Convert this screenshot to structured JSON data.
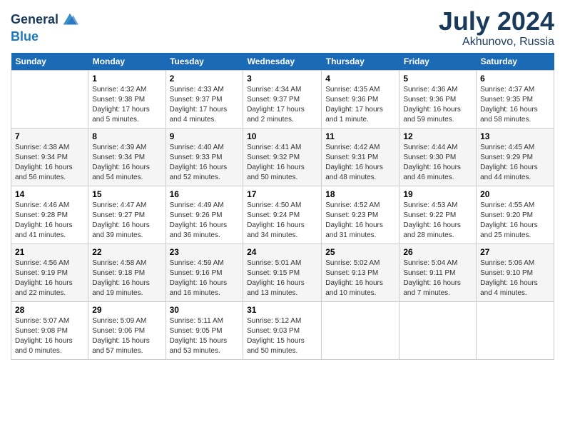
{
  "header": {
    "logo_line1": "General",
    "logo_line2": "Blue",
    "month": "July 2024",
    "location": "Akhunovo, Russia"
  },
  "days_of_week": [
    "Sunday",
    "Monday",
    "Tuesday",
    "Wednesday",
    "Thursday",
    "Friday",
    "Saturday"
  ],
  "weeks": [
    [
      {
        "day": "",
        "sunrise": "",
        "sunset": "",
        "daylight": ""
      },
      {
        "day": "1",
        "sunrise": "Sunrise: 4:32 AM",
        "sunset": "Sunset: 9:38 PM",
        "daylight": "Daylight: 17 hours and 5 minutes."
      },
      {
        "day": "2",
        "sunrise": "Sunrise: 4:33 AM",
        "sunset": "Sunset: 9:37 PM",
        "daylight": "Daylight: 17 hours and 4 minutes."
      },
      {
        "day": "3",
        "sunrise": "Sunrise: 4:34 AM",
        "sunset": "Sunset: 9:37 PM",
        "daylight": "Daylight: 17 hours and 2 minutes."
      },
      {
        "day": "4",
        "sunrise": "Sunrise: 4:35 AM",
        "sunset": "Sunset: 9:36 PM",
        "daylight": "Daylight: 17 hours and 1 minute."
      },
      {
        "day": "5",
        "sunrise": "Sunrise: 4:36 AM",
        "sunset": "Sunset: 9:36 PM",
        "daylight": "Daylight: 16 hours and 59 minutes."
      },
      {
        "day": "6",
        "sunrise": "Sunrise: 4:37 AM",
        "sunset": "Sunset: 9:35 PM",
        "daylight": "Daylight: 16 hours and 58 minutes."
      }
    ],
    [
      {
        "day": "7",
        "sunrise": "Sunrise: 4:38 AM",
        "sunset": "Sunset: 9:34 PM",
        "daylight": "Daylight: 16 hours and 56 minutes."
      },
      {
        "day": "8",
        "sunrise": "Sunrise: 4:39 AM",
        "sunset": "Sunset: 9:34 PM",
        "daylight": "Daylight: 16 hours and 54 minutes."
      },
      {
        "day": "9",
        "sunrise": "Sunrise: 4:40 AM",
        "sunset": "Sunset: 9:33 PM",
        "daylight": "Daylight: 16 hours and 52 minutes."
      },
      {
        "day": "10",
        "sunrise": "Sunrise: 4:41 AM",
        "sunset": "Sunset: 9:32 PM",
        "daylight": "Daylight: 16 hours and 50 minutes."
      },
      {
        "day": "11",
        "sunrise": "Sunrise: 4:42 AM",
        "sunset": "Sunset: 9:31 PM",
        "daylight": "Daylight: 16 hours and 48 minutes."
      },
      {
        "day": "12",
        "sunrise": "Sunrise: 4:44 AM",
        "sunset": "Sunset: 9:30 PM",
        "daylight": "Daylight: 16 hours and 46 minutes."
      },
      {
        "day": "13",
        "sunrise": "Sunrise: 4:45 AM",
        "sunset": "Sunset: 9:29 PM",
        "daylight": "Daylight: 16 hours and 44 minutes."
      }
    ],
    [
      {
        "day": "14",
        "sunrise": "Sunrise: 4:46 AM",
        "sunset": "Sunset: 9:28 PM",
        "daylight": "Daylight: 16 hours and 41 minutes."
      },
      {
        "day": "15",
        "sunrise": "Sunrise: 4:47 AM",
        "sunset": "Sunset: 9:27 PM",
        "daylight": "Daylight: 16 hours and 39 minutes."
      },
      {
        "day": "16",
        "sunrise": "Sunrise: 4:49 AM",
        "sunset": "Sunset: 9:26 PM",
        "daylight": "Daylight: 16 hours and 36 minutes."
      },
      {
        "day": "17",
        "sunrise": "Sunrise: 4:50 AM",
        "sunset": "Sunset: 9:24 PM",
        "daylight": "Daylight: 16 hours and 34 minutes."
      },
      {
        "day": "18",
        "sunrise": "Sunrise: 4:52 AM",
        "sunset": "Sunset: 9:23 PM",
        "daylight": "Daylight: 16 hours and 31 minutes."
      },
      {
        "day": "19",
        "sunrise": "Sunrise: 4:53 AM",
        "sunset": "Sunset: 9:22 PM",
        "daylight": "Daylight: 16 hours and 28 minutes."
      },
      {
        "day": "20",
        "sunrise": "Sunrise: 4:55 AM",
        "sunset": "Sunset: 9:20 PM",
        "daylight": "Daylight: 16 hours and 25 minutes."
      }
    ],
    [
      {
        "day": "21",
        "sunrise": "Sunrise: 4:56 AM",
        "sunset": "Sunset: 9:19 PM",
        "daylight": "Daylight: 16 hours and 22 minutes."
      },
      {
        "day": "22",
        "sunrise": "Sunrise: 4:58 AM",
        "sunset": "Sunset: 9:18 PM",
        "daylight": "Daylight: 16 hours and 19 minutes."
      },
      {
        "day": "23",
        "sunrise": "Sunrise: 4:59 AM",
        "sunset": "Sunset: 9:16 PM",
        "daylight": "Daylight: 16 hours and 16 minutes."
      },
      {
        "day": "24",
        "sunrise": "Sunrise: 5:01 AM",
        "sunset": "Sunset: 9:15 PM",
        "daylight": "Daylight: 16 hours and 13 minutes."
      },
      {
        "day": "25",
        "sunrise": "Sunrise: 5:02 AM",
        "sunset": "Sunset: 9:13 PM",
        "daylight": "Daylight: 16 hours and 10 minutes."
      },
      {
        "day": "26",
        "sunrise": "Sunrise: 5:04 AM",
        "sunset": "Sunset: 9:11 PM",
        "daylight": "Daylight: 16 hours and 7 minutes."
      },
      {
        "day": "27",
        "sunrise": "Sunrise: 5:06 AM",
        "sunset": "Sunset: 9:10 PM",
        "daylight": "Daylight: 16 hours and 4 minutes."
      }
    ],
    [
      {
        "day": "28",
        "sunrise": "Sunrise: 5:07 AM",
        "sunset": "Sunset: 9:08 PM",
        "daylight": "Daylight: 16 hours and 0 minutes."
      },
      {
        "day": "29",
        "sunrise": "Sunrise: 5:09 AM",
        "sunset": "Sunset: 9:06 PM",
        "daylight": "Daylight: 15 hours and 57 minutes."
      },
      {
        "day": "30",
        "sunrise": "Sunrise: 5:11 AM",
        "sunset": "Sunset: 9:05 PM",
        "daylight": "Daylight: 15 hours and 53 minutes."
      },
      {
        "day": "31",
        "sunrise": "Sunrise: 5:12 AM",
        "sunset": "Sunset: 9:03 PM",
        "daylight": "Daylight: 15 hours and 50 minutes."
      },
      {
        "day": "",
        "sunrise": "",
        "sunset": "",
        "daylight": ""
      },
      {
        "day": "",
        "sunrise": "",
        "sunset": "",
        "daylight": ""
      },
      {
        "day": "",
        "sunrise": "",
        "sunset": "",
        "daylight": ""
      }
    ]
  ]
}
